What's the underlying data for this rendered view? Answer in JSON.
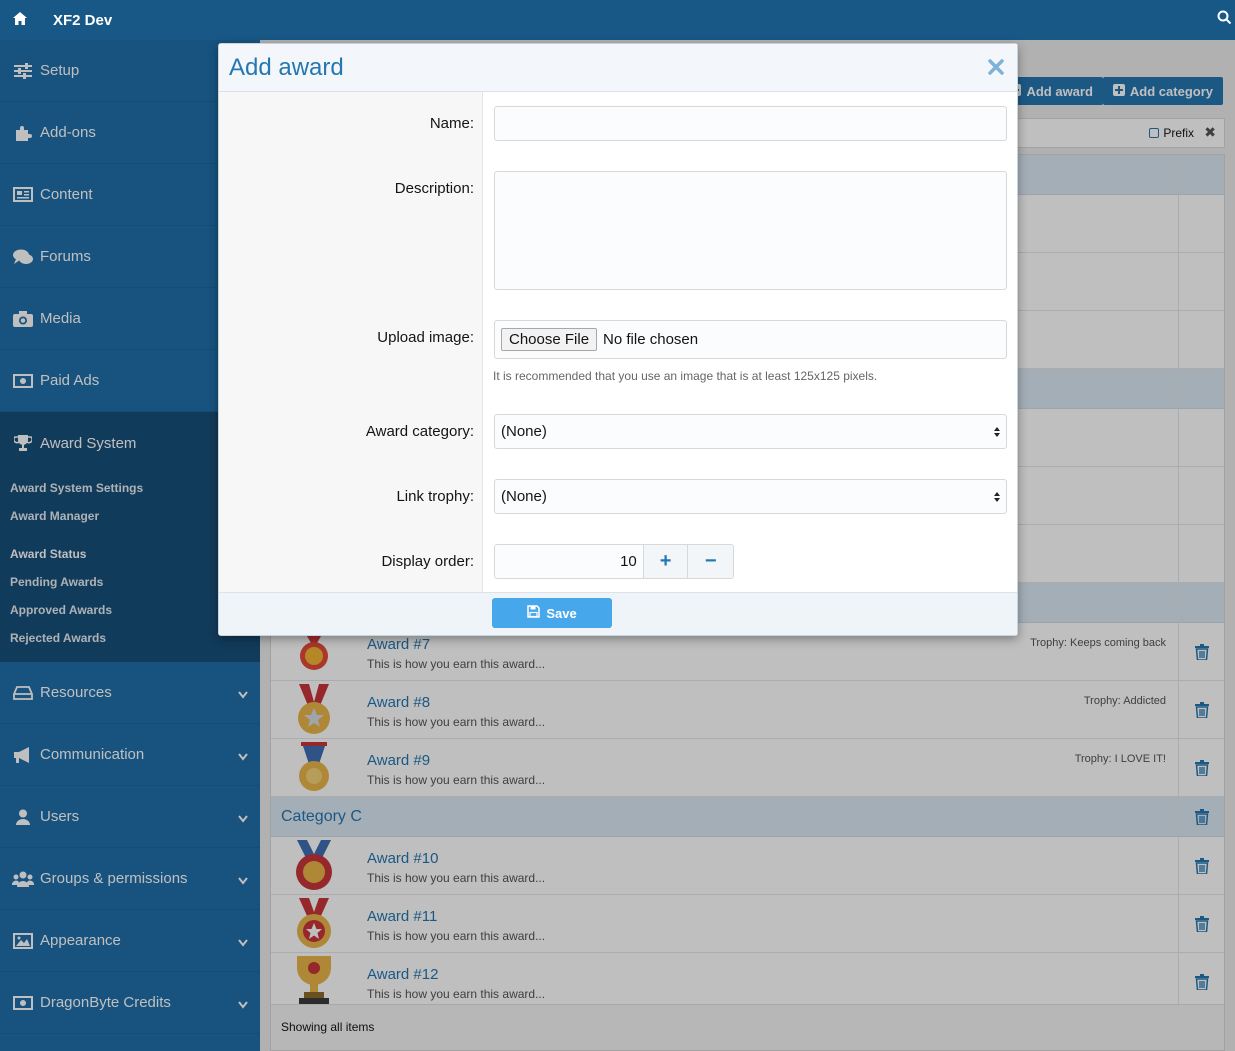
{
  "topbar": {
    "title": "XF2 Dev",
    "home_icon": "home-icon",
    "search_icon": "search-icon"
  },
  "sidebar": {
    "items_top": [
      {
        "label": "Setup",
        "icon": "sliders-icon"
      },
      {
        "label": "Add-ons",
        "icon": "puzzle-icon"
      },
      {
        "label": "Content",
        "icon": "newspaper-icon"
      },
      {
        "label": "Forums",
        "icon": "comments-icon"
      },
      {
        "label": "Media",
        "icon": "camera-icon"
      },
      {
        "label": "Paid Ads",
        "icon": "money-icon"
      }
    ],
    "award_section": {
      "label": "Award System",
      "icon": "trophy-icon",
      "subs_a": [
        "Award System Settings",
        "Award Manager"
      ],
      "subs_b": [
        "Award Status",
        "Pending Awards",
        "Approved Awards",
        "Rejected Awards"
      ]
    },
    "items_bottom": [
      {
        "label": "Resources",
        "icon": "hdd-icon"
      },
      {
        "label": "Communication",
        "icon": "bullhorn-icon"
      },
      {
        "label": "Users",
        "icon": "user-icon"
      },
      {
        "label": "Groups & permissions",
        "icon": "users-icon"
      },
      {
        "label": "Appearance",
        "icon": "image-icon"
      },
      {
        "label": "DragonByte Credits",
        "icon": "money-icon"
      }
    ]
  },
  "main": {
    "add_award_label": "Add award",
    "add_category_label": "Add category",
    "prefix_label": "Prefix",
    "rows_before": [
      {
        "name": "Award #7",
        "desc": "This is how you earn this award...",
        "trophy": "Trophy: Keeps coming back"
      },
      {
        "name": "Award #8",
        "desc": "This is how you earn this award...",
        "trophy": "Trophy: Addicted"
      },
      {
        "name": "Award #9",
        "desc": "This is how you earn this award...",
        "trophy": "Trophy: I LOVE IT!"
      }
    ],
    "category_c": "Category C",
    "rows_after": [
      {
        "name": "Award #10",
        "desc": "This is how you earn this award...",
        "trophy": ""
      },
      {
        "name": "Award #11",
        "desc": "This is how you earn this award...",
        "trophy": ""
      },
      {
        "name": "Award #12",
        "desc": "This is how you earn this award...",
        "trophy": ""
      }
    ],
    "footer": "Showing all items"
  },
  "modal": {
    "title": "Add award",
    "name_label": "Name:",
    "description_label": "Description:",
    "upload_label": "Upload image:",
    "choose_file": "Choose File",
    "no_file": "No file chosen",
    "upload_hint": "It is recommended that you use an image that is at least 125x125 pixels.",
    "category_label": "Award category:",
    "category_value": "(None)",
    "trophy_label": "Link trophy:",
    "trophy_value": "(None)",
    "order_label": "Display order:",
    "order_value": "10",
    "plus": "+",
    "minus": "−",
    "save_label": "Save"
  },
  "colors": {
    "accent": "#2577b1",
    "sidebar": "#1f6fa8",
    "topbar": "#185886",
    "save": "#47a7eb"
  }
}
